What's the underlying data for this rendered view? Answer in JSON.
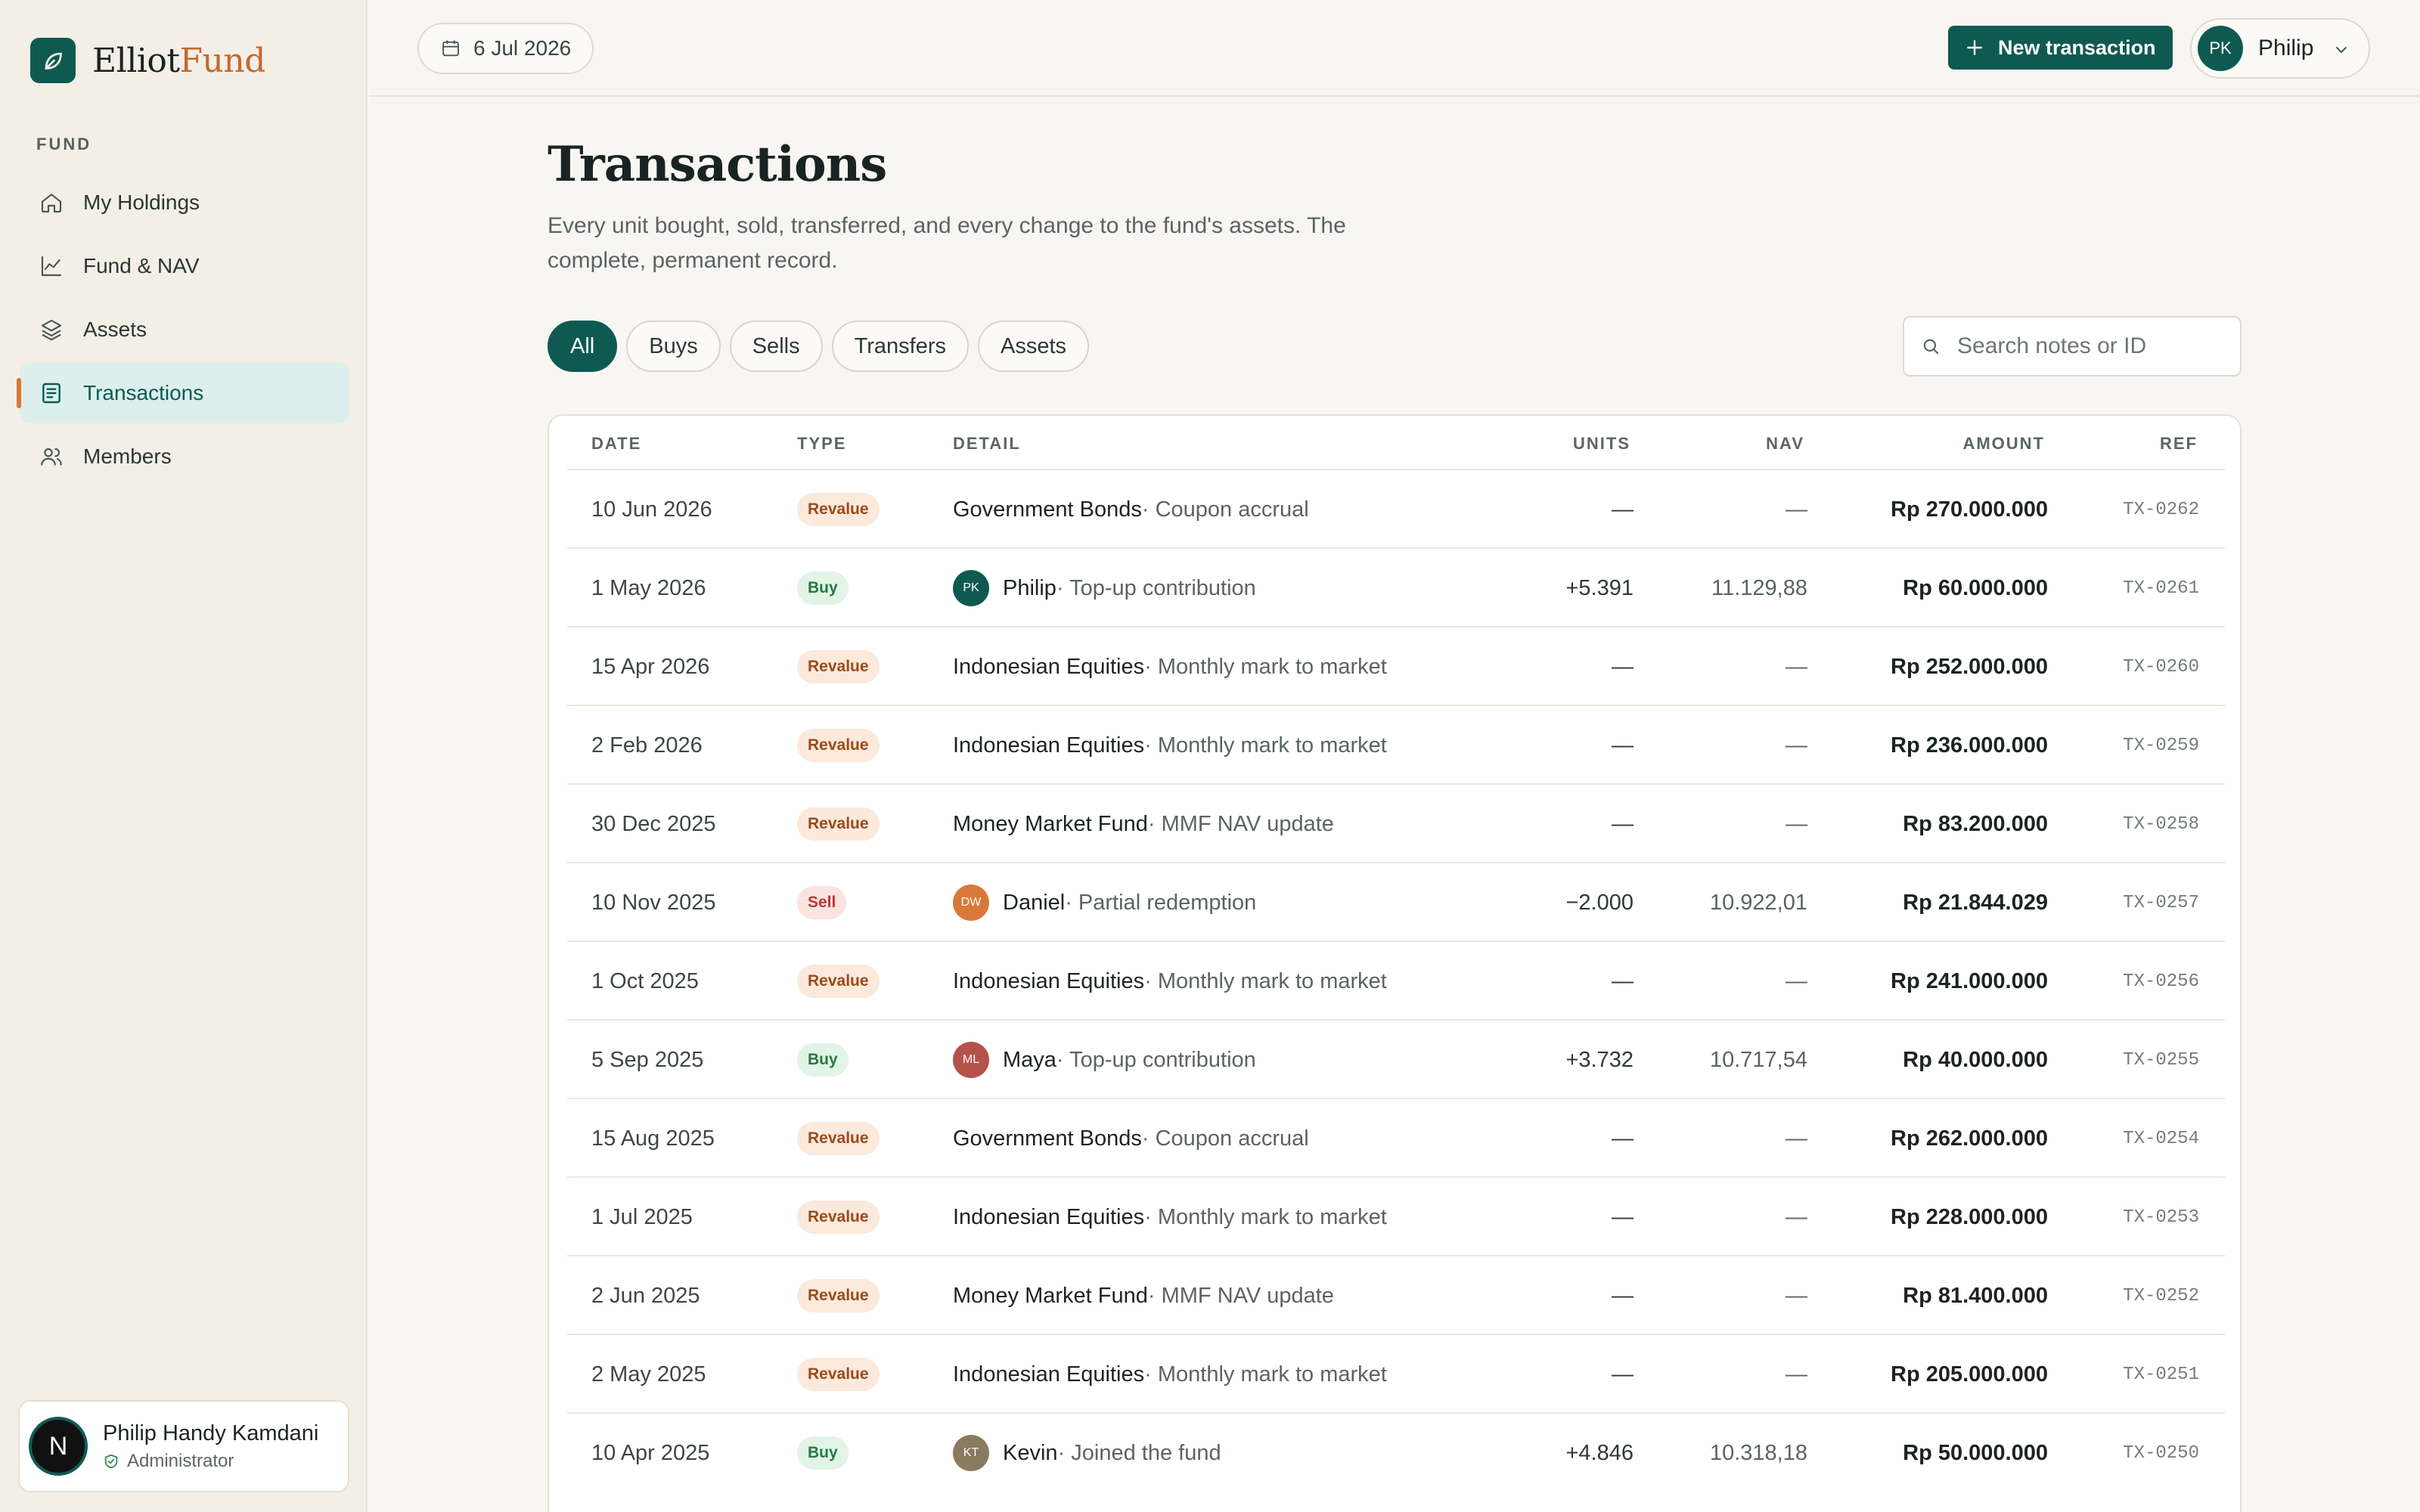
{
  "brand": {
    "name_part1": "Elliot",
    "name_part2": "Fund",
    "logo_icon": "leaf-icon"
  },
  "sidebar": {
    "section_label": "FUND",
    "items": [
      {
        "label": "My Holdings",
        "icon": "home-icon",
        "active": false
      },
      {
        "label": "Fund & NAV",
        "icon": "chart-line-icon",
        "active": false
      },
      {
        "label": "Assets",
        "icon": "layers-icon",
        "active": false
      },
      {
        "label": "Transactions",
        "icon": "receipt-icon",
        "active": true
      },
      {
        "label": "Members",
        "icon": "users-icon",
        "active": false
      }
    ],
    "user": {
      "initial": "N",
      "name": "Philip Handy Kamdani",
      "role": "Administrator"
    }
  },
  "topbar": {
    "date": "6 Jul 2026",
    "new_transaction_label": "New transaction",
    "profile": {
      "initials": "PK",
      "name": "Philip"
    }
  },
  "page": {
    "title": "Transactions",
    "description": "Every unit bought, sold, transferred, and every change to the fund's assets. The complete, permanent record."
  },
  "filters": [
    "All",
    "Buys",
    "Sells",
    "Transfers",
    "Assets"
  ],
  "active_filter": "All",
  "search": {
    "placeholder": "Search notes or ID",
    "value": ""
  },
  "table": {
    "columns": {
      "date": "DATE",
      "type": "TYPE",
      "detail": "DETAIL",
      "units": "UNITS",
      "nav": "NAV",
      "amount": "AMOUNT",
      "ref": "REF"
    },
    "rows": [
      {
        "date": "10 Jun 2026",
        "type": "Revalue",
        "kind": "revalue",
        "main": "Government Bonds",
        "note": " · Coupon accrual",
        "units": "—",
        "nav": "—",
        "amount": "Rp 270.000.000",
        "ref": "TX-0262"
      },
      {
        "date": "1 May 2026",
        "type": "Buy",
        "kind": "buy",
        "avatar": "PK",
        "avatar_color": "#0e5a51",
        "main": "Philip",
        "note": " · Top-up contribution",
        "units": "+5.391",
        "nav": "11.129,88",
        "amount": "Rp 60.000.000",
        "ref": "TX-0261"
      },
      {
        "date": "15 Apr 2026",
        "type": "Revalue",
        "kind": "revalue",
        "main": "Indonesian Equities",
        "note": " · Monthly mark to market",
        "units": "—",
        "nav": "—",
        "amount": "Rp 252.000.000",
        "ref": "TX-0260"
      },
      {
        "date": "2 Feb 2026",
        "type": "Revalue",
        "kind": "revalue",
        "main": "Indonesian Equities",
        "note": " · Monthly mark to market",
        "units": "—",
        "nav": "—",
        "amount": "Rp 236.000.000",
        "ref": "TX-0259"
      },
      {
        "date": "30 Dec 2025",
        "type": "Revalue",
        "kind": "revalue",
        "main": "Money Market Fund",
        "note": " · MMF NAV update",
        "units": "—",
        "nav": "—",
        "amount": "Rp 83.200.000",
        "ref": "TX-0258"
      },
      {
        "date": "10 Nov 2025",
        "type": "Sell",
        "kind": "sell",
        "avatar": "DW",
        "avatar_color": "#d9783a",
        "main": "Daniel",
        "note": " · Partial redemption",
        "units": "−2.000",
        "nav": "10.922,01",
        "amount": "Rp 21.844.029",
        "ref": "TX-0257"
      },
      {
        "date": "1 Oct 2025",
        "type": "Revalue",
        "kind": "revalue",
        "main": "Indonesian Equities",
        "note": " · Monthly mark to market",
        "units": "—",
        "nav": "—",
        "amount": "Rp 241.000.000",
        "ref": "TX-0256"
      },
      {
        "date": "5 Sep 2025",
        "type": "Buy",
        "kind": "buy",
        "avatar": "ML",
        "avatar_color": "#b5524a",
        "main": "Maya",
        "note": " · Top-up contribution",
        "units": "+3.732",
        "nav": "10.717,54",
        "amount": "Rp 40.000.000",
        "ref": "TX-0255"
      },
      {
        "date": "15 Aug 2025",
        "type": "Revalue",
        "kind": "revalue",
        "main": "Government Bonds",
        "note": " · Coupon accrual",
        "units": "—",
        "nav": "—",
        "amount": "Rp 262.000.000",
        "ref": "TX-0254"
      },
      {
        "date": "1 Jul 2025",
        "type": "Revalue",
        "kind": "revalue",
        "main": "Indonesian Equities",
        "note": " · Monthly mark to market",
        "units": "—",
        "nav": "—",
        "amount": "Rp 228.000.000",
        "ref": "TX-0253"
      },
      {
        "date": "2 Jun 2025",
        "type": "Revalue",
        "kind": "revalue",
        "main": "Money Market Fund",
        "note": " · MMF NAV update",
        "units": "—",
        "nav": "—",
        "amount": "Rp 81.400.000",
        "ref": "TX-0252"
      },
      {
        "date": "2 May 2025",
        "type": "Revalue",
        "kind": "revalue",
        "main": "Indonesian Equities",
        "note": " · Monthly mark to market",
        "units": "—",
        "nav": "—",
        "amount": "Rp 205.000.000",
        "ref": "TX-0251"
      },
      {
        "date": "10 Apr 2025",
        "type": "Buy",
        "kind": "buy",
        "avatar": "KT",
        "avatar_color": "#8a7a5e",
        "main": "Kevin",
        "note": " · Joined the fund",
        "units": "+4.846",
        "nav": "10.318,18",
        "amount": "Rp 50.000.000",
        "ref": "TX-0250"
      }
    ]
  },
  "colors": {
    "accent": "#0e5a51",
    "brand_orange": "#c26a2c",
    "revalue_bg": "#fbe9dc",
    "buy_bg": "#e1f4e6",
    "sell_bg": "#fbe3e1"
  }
}
